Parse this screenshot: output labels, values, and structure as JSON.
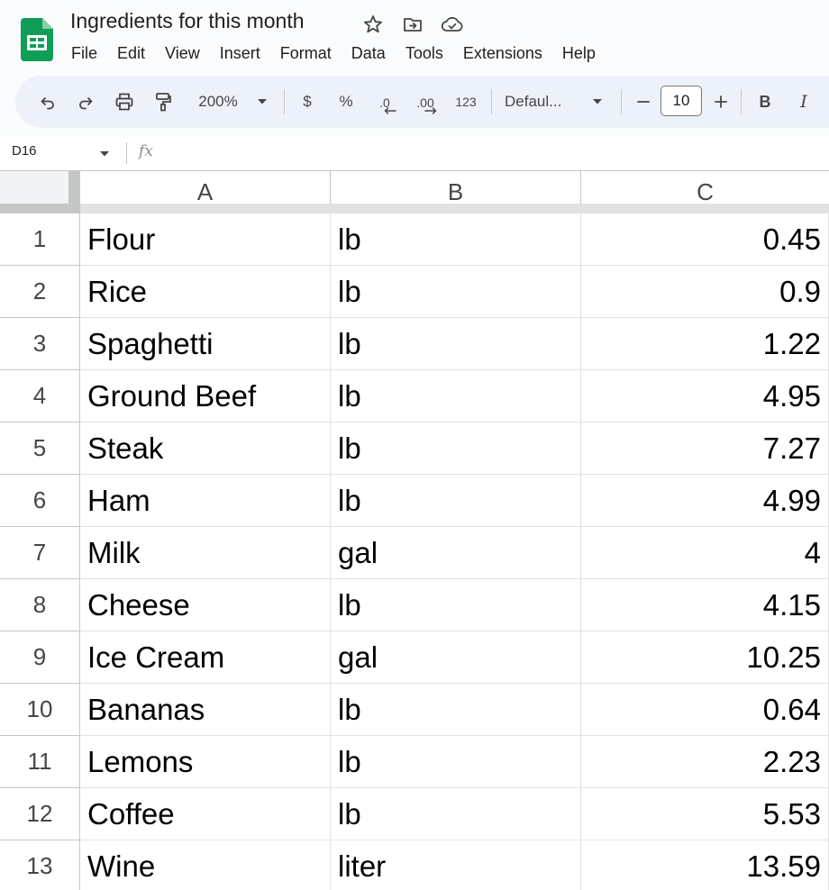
{
  "document": {
    "title": "Ingredients for this month"
  },
  "menu": [
    {
      "label": "File"
    },
    {
      "label": "Edit"
    },
    {
      "label": "View"
    },
    {
      "label": "Insert"
    },
    {
      "label": "Format"
    },
    {
      "label": "Data"
    },
    {
      "label": "Tools"
    },
    {
      "label": "Extensions"
    },
    {
      "label": "Help"
    }
  ],
  "toolbar": {
    "zoom": "200%",
    "currency_label": "$",
    "percent_label": "%",
    "decrease_decimal_label": ".0",
    "increase_decimal_label": ".00",
    "format_more_label": "123",
    "font_family": "Defaul...",
    "font_size": "10",
    "bold_label": "B",
    "italic_label": "I"
  },
  "formula_bar": {
    "cell_reference": "D16",
    "fx_label": "fx",
    "value": ""
  },
  "grid": {
    "columns": [
      "A",
      "B",
      "C"
    ],
    "rows": [
      {
        "num": "1",
        "a": "Flour",
        "b": "lb",
        "c": "0.45"
      },
      {
        "num": "2",
        "a": "Rice",
        "b": "lb",
        "c": "0.9"
      },
      {
        "num": "3",
        "a": "Spaghetti",
        "b": "lb",
        "c": "1.22"
      },
      {
        "num": "4",
        "a": "Ground Beef",
        "b": "lb",
        "c": "4.95"
      },
      {
        "num": "5",
        "a": "Steak",
        "b": "lb",
        "c": "7.27"
      },
      {
        "num": "6",
        "a": "Ham",
        "b": "lb",
        "c": "4.99"
      },
      {
        "num": "7",
        "a": "Milk",
        "b": "gal",
        "c": "4"
      },
      {
        "num": "8",
        "a": "Cheese",
        "b": "lb",
        "c": "4.15"
      },
      {
        "num": "9",
        "a": "Ice Cream",
        "b": "gal",
        "c": "10.25"
      },
      {
        "num": "10",
        "a": "Bananas",
        "b": "lb",
        "c": "0.64"
      },
      {
        "num": "11",
        "a": "Lemons",
        "b": "lb",
        "c": "2.23"
      },
      {
        "num": "12",
        "a": "Coffee",
        "b": "lb",
        "c": "5.53"
      },
      {
        "num": "13",
        "a": "Wine",
        "b": "liter",
        "c": "13.59"
      }
    ]
  },
  "colors": {
    "sheets_green": "#0f9d58",
    "chrome_bg": "#f9fbfd",
    "toolbar_bg": "#edf2fa",
    "gridline": "#e1e3e1"
  }
}
